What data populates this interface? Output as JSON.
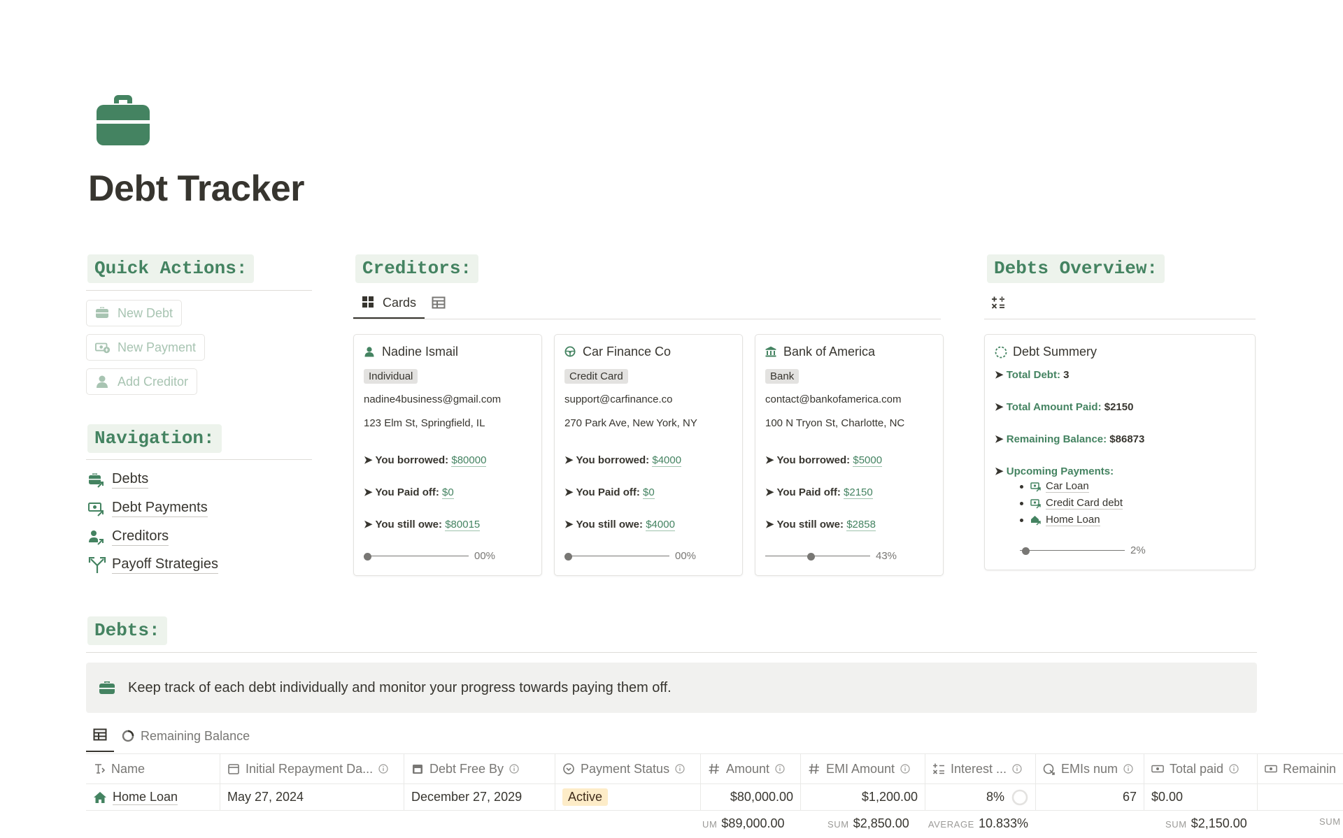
{
  "page": {
    "title": "Debt Tracker",
    "icon": "briefcase-icon"
  },
  "colors": {
    "accent": "#448361",
    "accent_bg": "#edf3ec",
    "text": "#37352f",
    "muted": "#787774",
    "status_active_bg": "#fdecc8"
  },
  "quick_actions": {
    "heading": "Quick Actions:",
    "buttons": [
      {
        "label": "New Debt",
        "icon": "briefcase-icon"
      },
      {
        "label": "New Payment",
        "icon": "money-icon"
      },
      {
        "label": "Add Creditor",
        "icon": "person-icon"
      }
    ]
  },
  "navigation": {
    "heading": "Navigation:",
    "links": [
      {
        "label": "Debts",
        "icon": "briefcase-link-icon"
      },
      {
        "label": "Debt Payments",
        "icon": "money-link-icon"
      },
      {
        "label": "Creditors",
        "icon": "person-link-icon"
      },
      {
        "label": "Payoff Strategies",
        "icon": "merge-arrows-icon"
      }
    ]
  },
  "creditors": {
    "heading": "Creditors:",
    "tabs": [
      {
        "label": "Cards",
        "icon": "gallery-icon"
      },
      {
        "label": "",
        "icon": "table-icon"
      }
    ],
    "cards": [
      {
        "name": "Nadine Ismail",
        "icon": "person-icon",
        "type": "Individual",
        "email": "nadine4business@gmail.com",
        "address": "123 Elm St, Springfield, IL",
        "borrowed_label": "➤ You borrowed:",
        "borrowed": "$80000",
        "paid_label": "➤ You Paid off:",
        "paid": "$0",
        "owe_label": "➤ You still owe:",
        "owe": "$80015",
        "progress_label": "00%",
        "progress": 0
      },
      {
        "name": "Car Finance Co",
        "icon": "steering-wheel-icon",
        "type": "Credit Card",
        "email": "support@carfinance.co",
        "address": "270 Park Ave, New York, NY",
        "borrowed_label": "➤ You borrowed:",
        "borrowed": "$4000",
        "paid_label": "➤ You Paid off:",
        "paid": "$0",
        "owe_label": "➤ You still owe:",
        "owe": "$4000",
        "progress_label": "00%",
        "progress": 0
      },
      {
        "name": "Bank of America",
        "icon": "bank-icon",
        "type": "Bank",
        "email": "contact@bankofamerica.com",
        "address": "100 N Tryon St, Charlotte, NC",
        "borrowed_label": "➤ You borrowed:",
        "borrowed": "$5000",
        "paid_label": "➤ You Paid off:",
        "paid": "$2150",
        "owe_label": "➤ You still owe:",
        "owe": "$2858",
        "progress_label": "43%",
        "progress": 0.43
      }
    ]
  },
  "overview": {
    "heading": "Debts Overview:",
    "tab_icon": "formula-icon",
    "card": {
      "title": "Debt Summery",
      "icon": "dashed-circle-icon",
      "total_debt_label": "Total Debt:",
      "total_debt": "3",
      "total_paid_label": "Total Amount Paid:",
      "total_paid": "$2150",
      "remaining_label": "Remaining Balance:",
      "remaining": "$86873",
      "upcoming_label": "Upcoming Payments:",
      "upcoming": [
        "Car Loan",
        "Credit Card debt",
        "Home Loan"
      ],
      "progress_label": "2%",
      "progress": 0.02
    }
  },
  "debts": {
    "heading": "Debts:",
    "callout": "Keep track of each debt individually and monitor your progress towards paying them off.",
    "tabs": [
      {
        "label": "",
        "icon": "table-icon"
      },
      {
        "label": "Remaining Balance",
        "icon": "pie-chart-icon"
      }
    ],
    "columns": [
      "Name",
      "Initial Repayment Da...",
      "Debt Free By",
      "Payment Status",
      "Amount",
      "EMI Amount",
      "Interest ...",
      "EMIs num",
      "Total paid",
      "Remainin"
    ],
    "rows": [
      {
        "name": "Home Loan",
        "initial": "May 27, 2024",
        "free_by": "December 27, 2029",
        "status": "Active",
        "amount": "$80,000.00",
        "emi": "$1,200.00",
        "interest": "8%",
        "emis": "67",
        "total_paid": "$0.00"
      }
    ],
    "footer": {
      "amount_label": "UM",
      "amount": "$89,000.00",
      "emi_label": "SUM",
      "emi": "$2,850.00",
      "interest_label": "AVERAGE",
      "interest": "10.833%",
      "paid_label": "SUM",
      "paid": "$2,150.00",
      "remaining_label": "SUM"
    }
  }
}
